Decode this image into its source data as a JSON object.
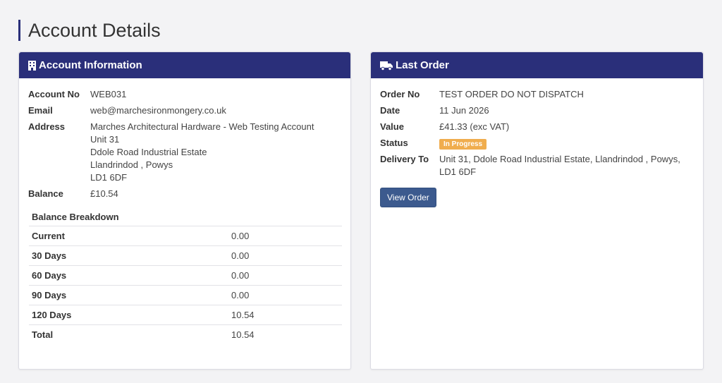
{
  "page": {
    "title": "Account Details"
  },
  "account": {
    "header": "Account Information",
    "icon": "building-icon",
    "fields": {
      "account_no_label": "Account No",
      "account_no": "WEB031",
      "email_label": "Email",
      "email": "web@marchesironmongery.co.uk",
      "address_label": "Address",
      "address": [
        "Marches Architectural Hardware - Web Testing Account",
        "Unit 31",
        "Ddole Road Industrial Estate",
        "Llandrindod , Powys",
        "LD1 6DF"
      ],
      "balance_label": "Balance",
      "balance": "£10.54"
    },
    "breakdown": {
      "title": "Balance Breakdown",
      "rows": [
        {
          "label": "Current",
          "value": "0.00"
        },
        {
          "label": "30 Days",
          "value": "0.00"
        },
        {
          "label": "60 Days",
          "value": "0.00"
        },
        {
          "label": "90 Days",
          "value": "0.00"
        },
        {
          "label": "120 Days",
          "value": "10.54"
        },
        {
          "label": "Total",
          "value": "10.54"
        }
      ]
    }
  },
  "last_order": {
    "header": "Last Order",
    "icon": "truck-icon",
    "order_no_label": "Order No",
    "order_no": "TEST ORDER DO NOT DISPATCH",
    "date_label": "Date",
    "date": "11 Jun 2026",
    "value_label": "Value",
    "value": "£41.33 (exc VAT)",
    "status_label": "Status",
    "status": "In Progress",
    "delivery_label": "Delivery To",
    "delivery": [
      "Unit 31, Ddole Road Industrial Estate, Llandrindod , Powys,",
      "LD1 6DF"
    ],
    "view_button": "View Order"
  },
  "colors": {
    "header": "#2a2f7a",
    "badge": "#f0ad4e",
    "button": "#3c5a8e"
  }
}
